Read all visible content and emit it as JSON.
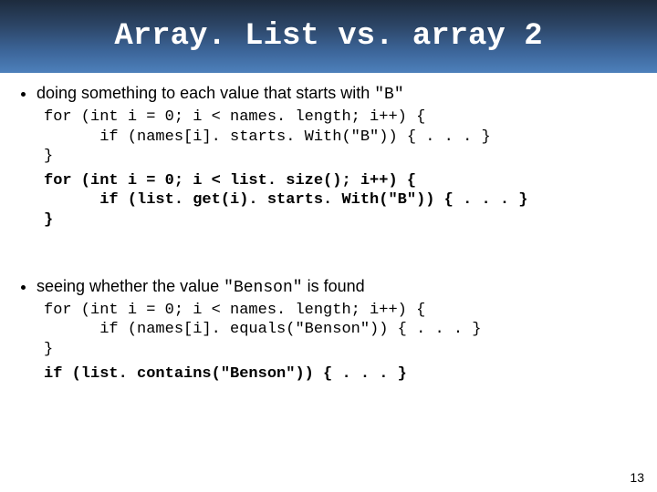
{
  "title": "Array. List vs. array 2",
  "bullets": {
    "b1_pre": "doing something to each value that starts with ",
    "b1_code": "\"B\"",
    "b2_pre": "seeing whether the value ",
    "b2_code": "\"Benson\"",
    "b2_post": " is found"
  },
  "code": {
    "c1": "for (int i = 0; i < names. length; i++) {\n      if (names[i]. starts. With(\"B\")) { . . . }\n}",
    "c2": "for (int i = 0; i < list. size(); i++) {\n      if (list. get(i). starts. With(\"B\")) { . . . }\n}",
    "c3": "for (int i = 0; i < names. length; i++) {\n      if (names[i]. equals(\"Benson\")) { . . . }\n}",
    "c4": "if (list. contains(\"Benson\")) { . . . }"
  },
  "page_number": "13"
}
